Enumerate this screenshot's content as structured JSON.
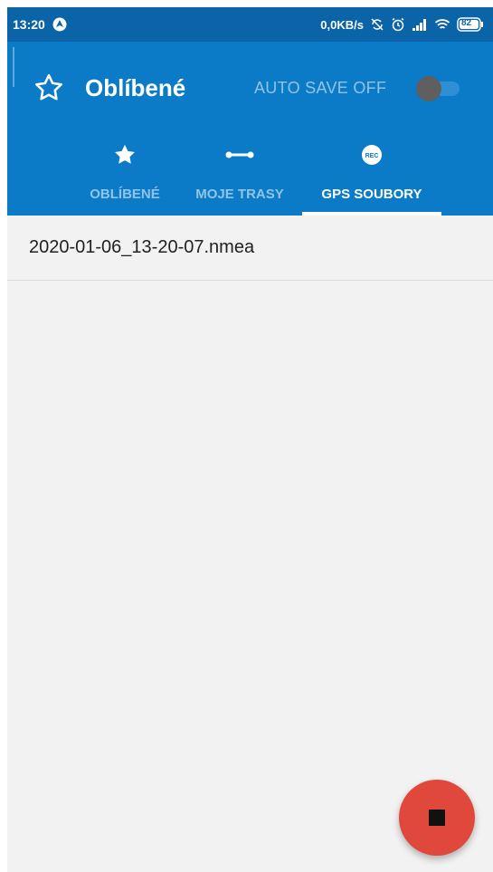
{
  "status_bar": {
    "time": "13:20",
    "network_speed": "0,0KB/s",
    "battery": "82",
    "icons": [
      "navigation-icon",
      "sync-off-icon",
      "alarm-icon",
      "signal-icon",
      "wifi-icon",
      "battery-icon"
    ]
  },
  "app_bar": {
    "title": "Oblíbené",
    "title_icon": "star-outline-icon",
    "auto_save_label": "AUTO SAVE OFF",
    "auto_save_enabled": false
  },
  "tabs": [
    {
      "label": "OBLÍBENÉ",
      "icon": "star-icon",
      "active": false
    },
    {
      "label": "MOJE TRASY",
      "icon": "route-icon",
      "active": false
    },
    {
      "label": "GPS SOUBORY",
      "icon": "rec-icon",
      "active": true
    }
  ],
  "files": [
    {
      "name": "2020-01-06_13-20-07.nmea"
    }
  ],
  "fab": {
    "icon": "stop-icon"
  },
  "colors": {
    "status_bar": "#0b63a8",
    "primary": "#0b7bc8",
    "fab": "#e0483b",
    "background": "#f2f2f2"
  }
}
